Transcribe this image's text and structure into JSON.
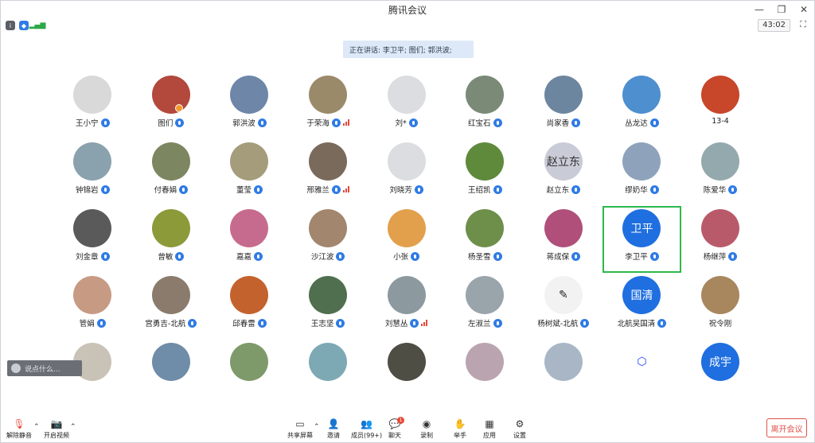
{
  "window": {
    "title": "腾讯会议"
  },
  "status": {
    "timer": "43:02"
  },
  "speaking": {
    "text": "正在讲话: 李卫平; 图们; 郭洪波;"
  },
  "participants": [
    {
      "name": "王小宁",
      "color": "#d9d9d9",
      "mic": true
    },
    {
      "name": "图们",
      "color": "#b3483c",
      "mic": true,
      "hand": true
    },
    {
      "name": "郭洪波",
      "color": "#6e86a8",
      "mic": true
    },
    {
      "name": "于荣海",
      "color": "#9b8a6a",
      "mic": true,
      "signal": true
    },
    {
      "name": "刘*",
      "color": "#dcdde0",
      "mic": true
    },
    {
      "name": "红宝石",
      "color": "#7a8a76",
      "mic": true
    },
    {
      "name": "尚家香",
      "color": "#6c86a0",
      "mic": true
    },
    {
      "name": "丛龙达",
      "color": "#4d8fcf",
      "mic": true
    },
    {
      "name": "13-4",
      "color": "#c8462a",
      "mic": false
    },
    {
      "name": "钟锦岩",
      "color": "#8aa2ad",
      "mic": true
    },
    {
      "name": "付春娟",
      "color": "#7c8660",
      "mic": true
    },
    {
      "name": "董莹",
      "color": "#a59c7c",
      "mic": true
    },
    {
      "name": "邢雅兰",
      "color": "#7a6a5c",
      "mic": true,
      "signal": true
    },
    {
      "name": "刘晓芳",
      "color": "#dcdde0",
      "mic": true
    },
    {
      "name": "王绍凯",
      "color": "#5f8a3c",
      "mic": true
    },
    {
      "name": "赵立东",
      "color": "#c9cbd6",
      "mic": true,
      "avatarText": "赵立东",
      "avatarTextColor": "#333"
    },
    {
      "name": "缪奶华",
      "color": "#8ea3bb",
      "mic": true
    },
    {
      "name": "陈爱华",
      "color": "#94a9ad",
      "mic": true
    },
    {
      "name": "刘金章",
      "color": "#5a5a5a",
      "mic": true
    },
    {
      "name": "曾敏",
      "color": "#8c9a3a",
      "mic": true
    },
    {
      "name": "嘉嘉",
      "color": "#c76b8e",
      "mic": true
    },
    {
      "name": "沙江波",
      "color": "#a2866e",
      "mic": true
    },
    {
      "name": "小张",
      "color": "#e2a04c",
      "mic": true
    },
    {
      "name": "杨圣雪",
      "color": "#6d8f4a",
      "mic": true
    },
    {
      "name": "蒋成保",
      "color": "#b04f7a",
      "mic": true
    },
    {
      "name": "李卫平",
      "color": "#1f6fe0",
      "mic": true,
      "avatarText": "卫平",
      "active": true
    },
    {
      "name": "杨继萍",
      "color": "#b95a6b",
      "mic": true
    },
    {
      "name": "管娟",
      "color": "#c79a84",
      "mic": true
    },
    {
      "name": "宫勇吉-北航",
      "color": "#8b7b6c",
      "mic": true
    },
    {
      "name": "邱春雷",
      "color": "#c4622e",
      "mic": true
    },
    {
      "name": "王志坚",
      "color": "#4f6f4f",
      "mic": true
    },
    {
      "name": "刘慧丛",
      "color": "#8c9aa0",
      "mic": true,
      "signal": true
    },
    {
      "name": "左淑兰",
      "color": "#9aa4ab",
      "mic": true
    },
    {
      "name": "杨树斌-北航",
      "color": "#f2f2f2",
      "mic": true,
      "avatarText": "✎",
      "avatarTextColor": "#222"
    },
    {
      "name": "北航吴国清",
      "color": "#1f6fe0",
      "mic": true,
      "avatarText": "国清"
    },
    {
      "name": "祝令刚",
      "color": "#a8875f",
      "mic": false
    },
    {
      "name": "",
      "color": "#c9c2b6",
      "mic": false
    },
    {
      "name": "",
      "color": "#6f8ca8",
      "mic": false
    },
    {
      "name": "",
      "color": "#7e9a6a",
      "mic": false
    },
    {
      "name": "",
      "color": "#7da9b4",
      "mic": false
    },
    {
      "name": "",
      "color": "#4f4e44",
      "mic": false
    },
    {
      "name": "",
      "color": "#b9a4b0",
      "mic": false
    },
    {
      "name": "",
      "color": "#a8b6c6",
      "mic": false
    },
    {
      "name": "",
      "color": "#ffffff",
      "mic": false,
      "avatarText": "⬡",
      "avatarTextColor": "#1a3cff"
    },
    {
      "name": "",
      "color": "#1f6fe0",
      "mic": false,
      "avatarText": "成宇"
    }
  ],
  "chat": {
    "placeholder": "说点什么..."
  },
  "toolbar": {
    "unmute": "解除静音",
    "start_video": "开启视频",
    "share_screen": "共享屏幕",
    "invite": "邀请",
    "members": "成员(99+)",
    "chat": "聊天",
    "chat_badge": "1",
    "record": "录制",
    "raise_hand": "举手",
    "apps": "应用",
    "settings": "设置",
    "leave": "离开会议"
  }
}
